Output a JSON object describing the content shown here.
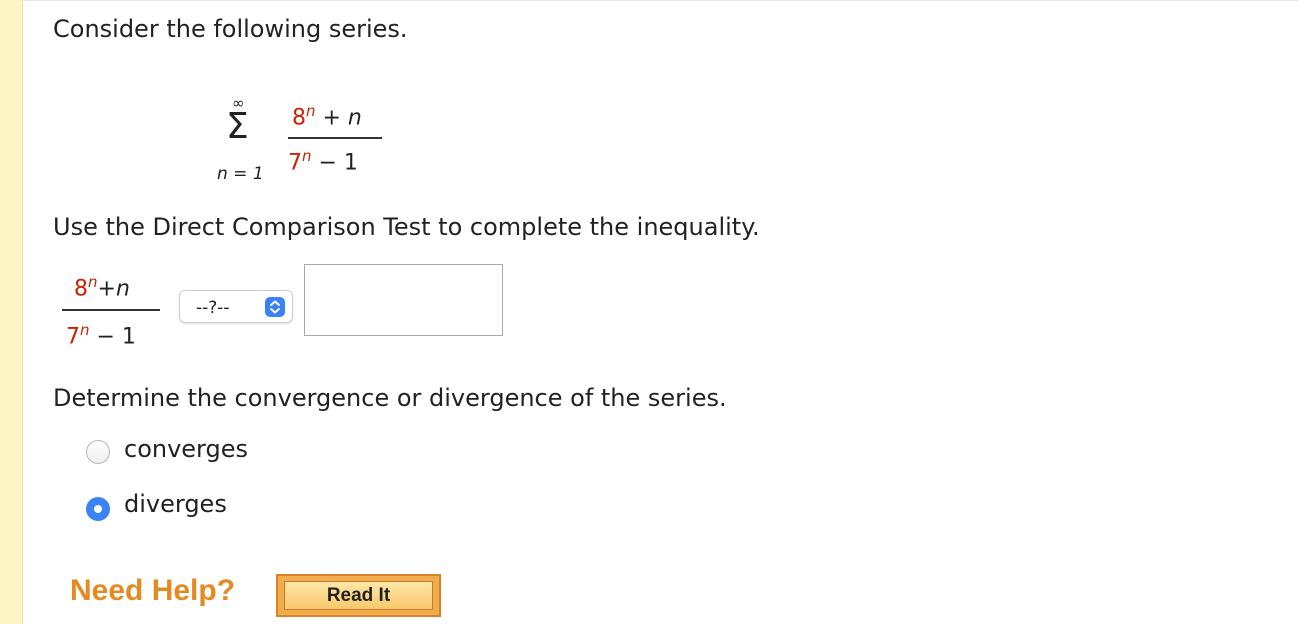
{
  "intro": "Consider the following series.",
  "series": {
    "upper_limit": "∞",
    "sigma": "Σ",
    "lower_limit": "n = 1",
    "num_base": "8",
    "num_exp": "n",
    "num_rest": " + n",
    "den_base": "7",
    "den_exp": "n",
    "den_rest": " − 1"
  },
  "instruction": "Use the Direct Comparison Test to complete the inequality.",
  "inequality": {
    "num_base": "8",
    "num_exp": "n",
    "num_rest": "+n",
    "den_base": "7",
    "den_exp": "n",
    "den_rest": " − 1",
    "select_value": "--?--",
    "select_icon": "updown-chevron-icon",
    "answer_value": ""
  },
  "question2": "Determine the convergence or divergence of the series.",
  "options": [
    {
      "label": "converges",
      "selected": false
    },
    {
      "label": "diverges",
      "selected": true
    }
  ],
  "help": {
    "label": "Need Help?",
    "button": "Read It"
  },
  "colors": {
    "accent_blue": "#3b82f6",
    "red_term": "#cc2200",
    "help_orange": "#e58a22",
    "left_strip": "#fdf6c4"
  }
}
